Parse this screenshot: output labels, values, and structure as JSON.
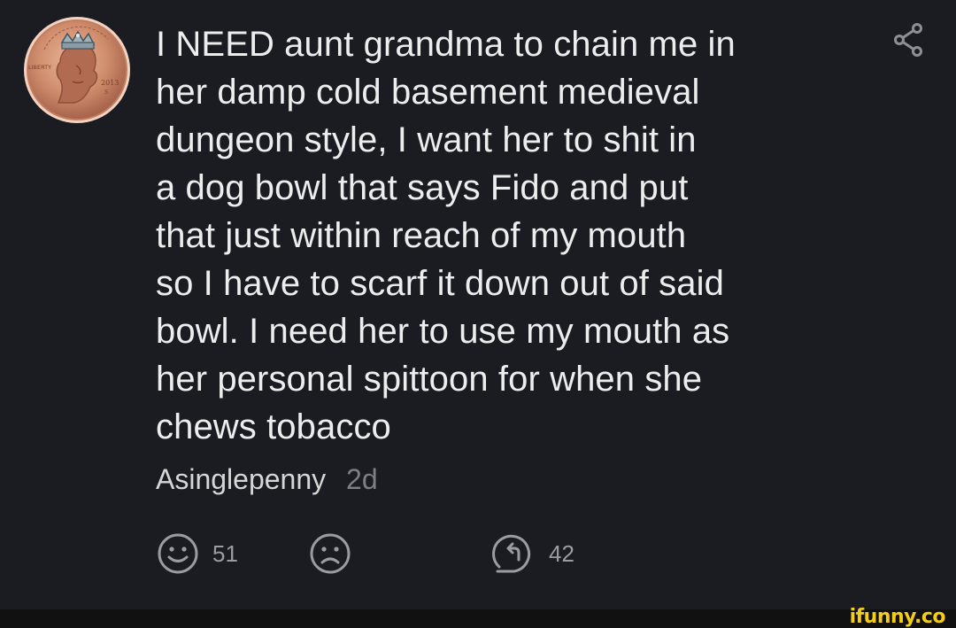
{
  "post": {
    "text_lines": [
      "I NEED aunt grandma to chain me in",
      "her damp cold basement medieval",
      "dungeon style, I want her to shit in",
      "a dog bowl that says Fido and put",
      "that just within reach of my mouth",
      "so I have to scarf it down out of said",
      "bowl. I need her to use my mouth as",
      "her personal spittoon for when she",
      "chews tobacco"
    ],
    "author": "Asinglepenny",
    "age": "2d",
    "avatar": {
      "icon": "penny-coin-avatar",
      "coin_text_liberty": "LIBERTY",
      "coin_year": "2013",
      "coin_mint": "S"
    },
    "share_icon": "share-icon"
  },
  "actions": {
    "like_icon": "smiley-icon",
    "like_count": "51",
    "dislike_icon": "frown-icon",
    "reply_icon": "reply-icon",
    "reply_count": "42"
  },
  "watermark": "ifunny.co",
  "colors": {
    "background": "#1b1c21",
    "text": "#ededed",
    "muted": "#7d7f86",
    "brand": "#f5cc16"
  }
}
